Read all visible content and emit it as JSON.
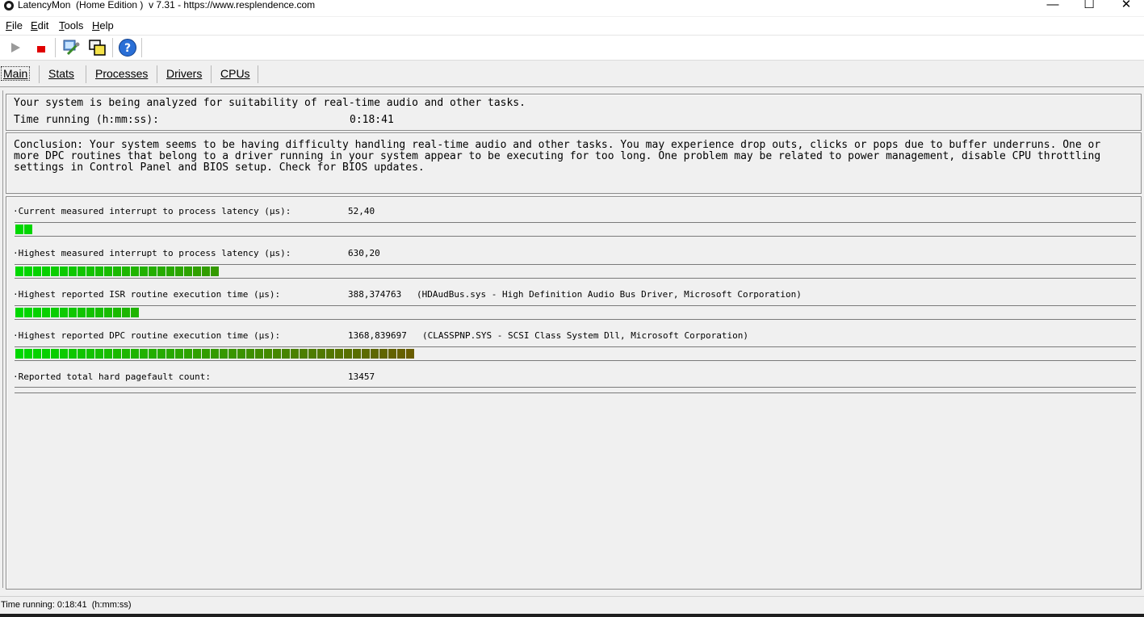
{
  "window": {
    "title": "LatencyMon  (Home Edition )  v 7.31 - https://www.resplendence.com",
    "controls": {
      "minimize": "—",
      "maximize": "☐",
      "close": "✕"
    }
  },
  "menu": [
    {
      "letter": "F",
      "rest": "ile"
    },
    {
      "letter": "E",
      "rest": "dit"
    },
    {
      "letter": "T",
      "rest": "ools"
    },
    {
      "letter": "H",
      "rest": "elp"
    }
  ],
  "toolbar": {
    "icons": [
      "play-icon",
      "stop-icon",
      "drivers-icon",
      "windows-icon",
      "help-icon"
    ]
  },
  "tabs": [
    "Main",
    "Stats",
    "Processes",
    "Drivers",
    "CPUs"
  ],
  "analysis": {
    "status_line": "Your system is being analyzed for suitability of real-time audio and other tasks.",
    "time_label": "Time running (h:mm:ss):",
    "time_value": "0:18:41"
  },
  "conclusion": "Conclusion: Your system seems to be having difficulty handling real-time audio and other tasks. You may experience drop outs, clicks or pops due to buffer underruns. One or more DPC routines that belong to a driver running in your system appear to be executing for too long. One problem may be related to power management, disable CPU throttling settings in Control Panel and BIOS setup. Check for BIOS updates.",
  "metrics": [
    {
      "label": "·Current measured interrupt to process latency (µs):",
      "value": "52,40",
      "extra": "",
      "bar_segments": 2
    },
    {
      "label": "·Highest measured interrupt to process latency (µs):",
      "value": "630,20",
      "extra": "",
      "bar_segments": 23
    },
    {
      "label": "·Highest reported ISR routine execution time (µs):",
      "value": "388,374763",
      "extra": "(HDAudBus.sys - High Definition Audio Bus Driver, Microsoft Corporation)",
      "bar_segments": 14
    },
    {
      "label": "·Highest reported DPC routine execution time (µs):",
      "value": "1368,839697",
      "extra": "(CLASSPNP.SYS - SCSI Class System Dll, Microsoft Corporation)",
      "bar_segments": 45
    },
    {
      "label": "·Reported total hard pagefault count:",
      "value": "13457",
      "extra": "",
      "bar_segments": 0
    }
  ],
  "colors": {
    "bar_start": "#00d800",
    "bar_end": "#6b5a00"
  },
  "statusbar": {
    "text": "Time running: 0:18:41  (h:mm:ss)"
  }
}
